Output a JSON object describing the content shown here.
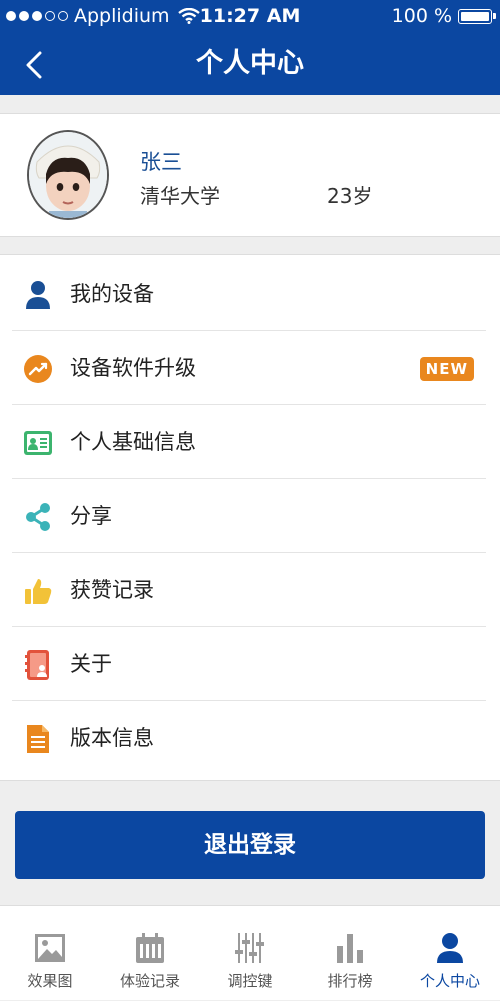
{
  "status_bar": {
    "carrier": "Applidium",
    "time": "11:27 AM",
    "battery": "100 %"
  },
  "header": {
    "title": "个人中心"
  },
  "profile": {
    "name": "张三",
    "school": "清华大学",
    "age": "23岁"
  },
  "menu": {
    "items": [
      {
        "label": "我的设备",
        "icon": "user-icon",
        "color": "#1a4f95"
      },
      {
        "label": "设备软件升级",
        "icon": "upgrade-icon",
        "color": "#e9871e",
        "badge": "NEW"
      },
      {
        "label": "个人基础信息",
        "icon": "id-card-icon",
        "color": "#3cb46e"
      },
      {
        "label": "分享",
        "icon": "share-icon",
        "color": "#3bb3b8"
      },
      {
        "label": "获赞记录",
        "icon": "thumbs-up-icon",
        "color": "#f2c238"
      },
      {
        "label": "关于",
        "icon": "about-icon",
        "color": "#e2523b"
      },
      {
        "label": "版本信息",
        "icon": "document-icon",
        "color": "#e9871e"
      }
    ]
  },
  "logout": {
    "label": "退出登录"
  },
  "tabbar": {
    "tabs": [
      {
        "label": "效果图",
        "icon": "image-icon"
      },
      {
        "label": "体验记录",
        "icon": "calendar-icon"
      },
      {
        "label": "调控键",
        "icon": "sliders-icon"
      },
      {
        "label": "排行榜",
        "icon": "bar-chart-icon"
      },
      {
        "label": "个人中心",
        "icon": "person-icon",
        "active": true
      }
    ],
    "active_color": "#0b47a1",
    "inactive_color": "#9a9a9a"
  },
  "colors": {
    "primary": "#0b47a1",
    "background": "#eeeeee"
  }
}
